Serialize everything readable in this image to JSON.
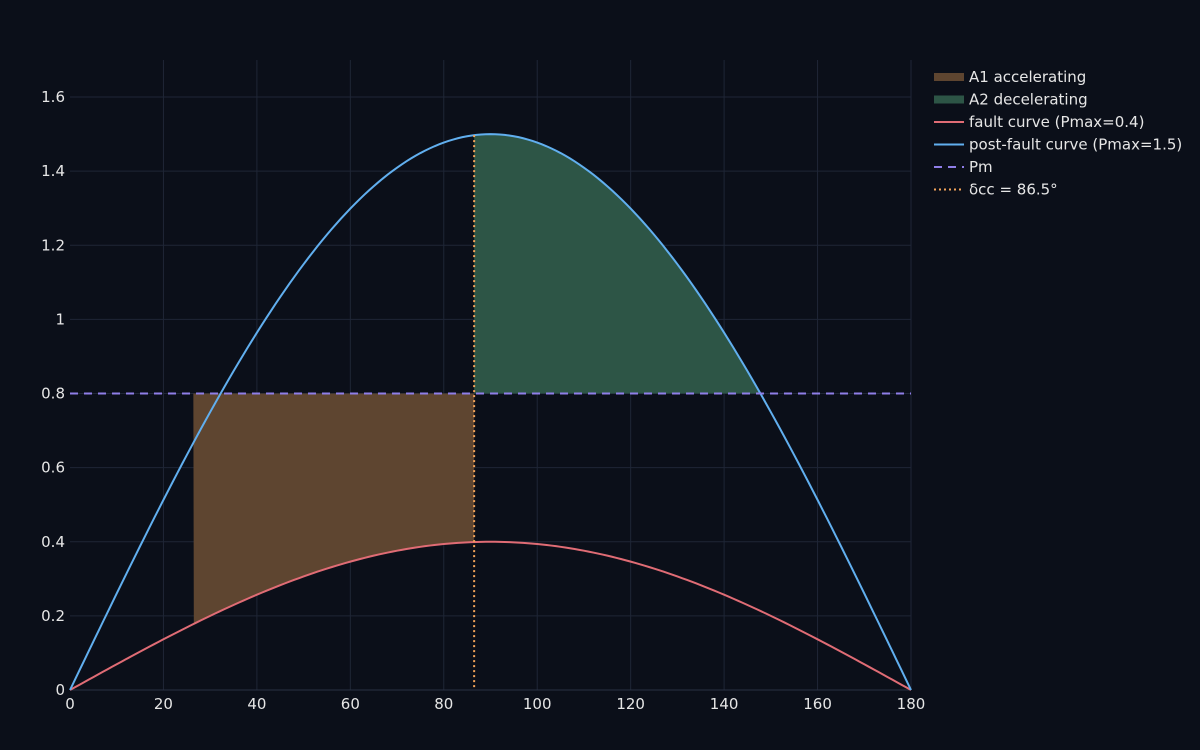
{
  "chart_data": {
    "type": "line",
    "xlim": [
      0,
      180
    ],
    "ylim": [
      0,
      1.7
    ],
    "x_ticks": [
      0,
      20,
      40,
      60,
      80,
      100,
      120,
      140,
      160,
      180
    ],
    "y_ticks": [
      0,
      0.2,
      0.4,
      0.6,
      0.8,
      1,
      1.2,
      1.4,
      1.6
    ],
    "grid": true,
    "legend_position": "top-right-outside",
    "pm": 0.8,
    "delta_0": 26.4,
    "delta_cc": 86.5,
    "delta_max": 147.8,
    "series": [
      {
        "name": "A1 accelerating",
        "kind": "area",
        "color": "#5e4530",
        "x_from": 26.4,
        "x_to": 86.5,
        "lower": "fault curve",
        "upper": "Pm"
      },
      {
        "name": "A2 decelerating",
        "kind": "area",
        "color": "#2d5546",
        "x_from": 86.5,
        "x_to": 147.8,
        "lower": "Pm",
        "upper": "post-fault curve"
      },
      {
        "name": "fault curve (Pmax=0.4)",
        "kind": "sine",
        "pmax": 0.4,
        "color": "#e06c75"
      },
      {
        "name": "post-fault curve (Pmax=1.5)",
        "kind": "sine",
        "pmax": 1.5,
        "color": "#61afef"
      },
      {
        "name": "Pm",
        "kind": "hline",
        "value": 0.8,
        "color": "#8f7ee8"
      },
      {
        "name": "δcc = 86.5°",
        "kind": "vline",
        "value": 86.5,
        "color": "#f5a55a"
      }
    ]
  }
}
